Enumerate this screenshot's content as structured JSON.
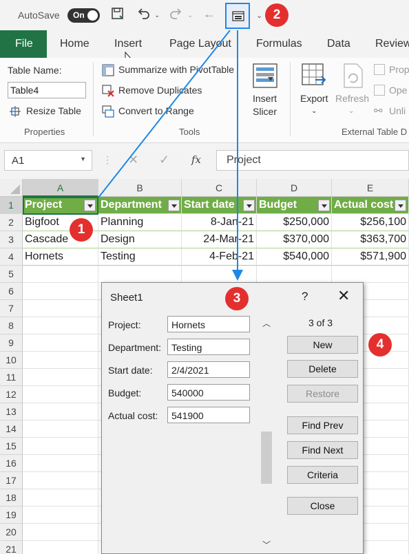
{
  "titlebar": {
    "autosave_label": "AutoSave",
    "toggle_label": "On"
  },
  "tabs": [
    "File",
    "Home",
    "Insert",
    "Page Layout",
    "Formulas",
    "Data",
    "Review"
  ],
  "ribbon": {
    "properties": {
      "table_name_label": "Table Name:",
      "table_name_value": "Table4",
      "resize_label": "Resize Table",
      "group_label": "Properties"
    },
    "tools": {
      "summarize": "Summarize with PivotTable",
      "remove_dup": "Remove Duplicates",
      "convert": "Convert to Range",
      "slicer_line1": "Insert",
      "slicer_line2": "Slicer",
      "group_label": "Tools"
    },
    "external": {
      "export": "Export",
      "refresh": "Refresh",
      "prop": "Prop",
      "open": "Ope",
      "unlink": "Unli",
      "group_label": "External Table D"
    }
  },
  "formula_bar": {
    "name_box": "A1",
    "fx": "fx",
    "value": "Project"
  },
  "grid": {
    "columns": [
      "A",
      "B",
      "C",
      "D",
      "E"
    ],
    "rows": [
      "1",
      "2",
      "3",
      "4",
      "5",
      "6",
      "7",
      "8",
      "9",
      "10",
      "11",
      "12",
      "13",
      "14",
      "15",
      "16",
      "17",
      "18",
      "19",
      "20",
      "21"
    ],
    "headers": [
      "Project",
      "Department",
      "Start date",
      "Budget",
      "Actual cost"
    ],
    "data": [
      [
        "Bigfoot",
        "Planning",
        "8-Jan-21",
        "$250,000",
        "$256,100"
      ],
      [
        "Cascade",
        "Design",
        "24-Mar-21",
        "$370,000",
        "$363,700"
      ],
      [
        "Hornets",
        "Testing",
        "4-Feb-21",
        "$540,000",
        "$571,900"
      ]
    ]
  },
  "dialog": {
    "title": "Sheet1",
    "help": "?",
    "close_x": "✕",
    "fields": [
      {
        "label": "Project:",
        "value": "Hornets"
      },
      {
        "label": "Department:",
        "value": "Testing"
      },
      {
        "label": "Start date:",
        "value": "2/4/2021"
      },
      {
        "label": "Budget:",
        "value": "540000"
      },
      {
        "label": "Actual cost:",
        "value": "541900"
      }
    ],
    "record_counter": "3 of 3",
    "buttons": {
      "new": "New",
      "delete": "Delete",
      "restore": "Restore",
      "find_prev": "Find Prev",
      "find_next": "Find Next",
      "criteria": "Criteria",
      "close": "Close"
    }
  },
  "badges": [
    "1",
    "2",
    "3",
    "4"
  ],
  "colors": {
    "excel_green": "#217346",
    "table_header": "#70ad47",
    "annotation_blue": "#1e88e5",
    "badge_red": "#e3302f"
  }
}
